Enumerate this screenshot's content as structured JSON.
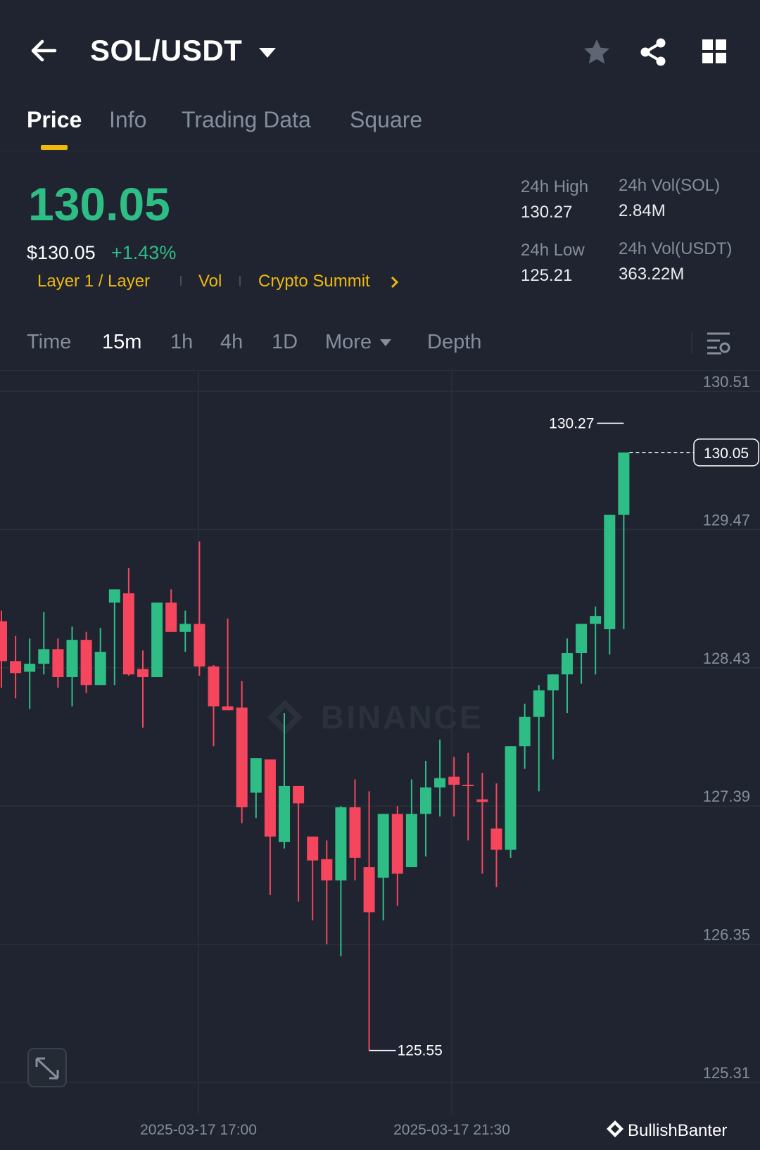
{
  "header": {
    "pair": "SOL/USDT",
    "back_icon": "arrow-left-icon",
    "icons": [
      "star-icon",
      "share-icon",
      "grid-icon"
    ]
  },
  "tabs": [
    {
      "label": "Price",
      "active": true
    },
    {
      "label": "Info",
      "active": false
    },
    {
      "label": "Trading Data",
      "active": false
    },
    {
      "label": "Square",
      "active": false
    }
  ],
  "price": {
    "last": "130.05",
    "usd": "$130.05",
    "change": "+1.43%",
    "color_up": "#2ebd85",
    "color_down": "#f6465d"
  },
  "tags": [
    "Layer 1 / Layer",
    "Vol",
    "Crypto Summit"
  ],
  "stats": {
    "high_label": "24h High",
    "high": "130.27",
    "low_label": "24h Low",
    "low": "125.21",
    "vol_base_label": "24h Vol(SOL)",
    "vol_base": "2.84M",
    "vol_quote_label": "24h Vol(USDT)",
    "vol_quote": "363.22M"
  },
  "timeframes": [
    {
      "label": "Time",
      "active": false
    },
    {
      "label": "15m",
      "active": true
    },
    {
      "label": "1h",
      "active": false
    },
    {
      "label": "4h",
      "active": false
    },
    {
      "label": "1D",
      "active": false
    },
    {
      "label": "More",
      "active": false
    },
    {
      "label": "Depth",
      "active": false
    }
  ],
  "chart_data": {
    "type": "candlestick",
    "y_ticks": [
      "130.51",
      "129.47",
      "128.43",
      "127.39",
      "126.35",
      "125.31"
    ],
    "ylim": [
      125.31,
      130.51
    ],
    "x_ticks": [
      "2025-03-17 17:00",
      "2025-03-17 21:30"
    ],
    "watermark": "BINANCE",
    "high_marker": "130.27",
    "low_marker": "125.55",
    "last_price": "130.05",
    "candles": [
      {
        "o": 128.78,
        "h": 128.86,
        "l": 128.28,
        "c": 128.48
      },
      {
        "o": 128.48,
        "h": 128.67,
        "l": 128.2,
        "c": 128.39
      },
      {
        "o": 128.4,
        "h": 128.65,
        "l": 128.12,
        "c": 128.46
      },
      {
        "o": 128.46,
        "h": 128.85,
        "l": 128.38,
        "c": 128.57
      },
      {
        "o": 128.57,
        "h": 128.65,
        "l": 128.28,
        "c": 128.36
      },
      {
        "o": 128.36,
        "h": 128.74,
        "l": 128.14,
        "c": 128.64
      },
      {
        "o": 128.64,
        "h": 128.7,
        "l": 128.24,
        "c": 128.3
      },
      {
        "o": 128.3,
        "h": 128.73,
        "l": 128.3,
        "c": 128.55
      },
      {
        "o": 128.92,
        "h": 128.98,
        "l": 128.3,
        "c": 129.02
      },
      {
        "o": 128.99,
        "h": 129.18,
        "l": 128.37,
        "c": 128.38
      },
      {
        "o": 128.42,
        "h": 128.56,
        "l": 127.98,
        "c": 128.36
      },
      {
        "o": 128.36,
        "h": 128.92,
        "l": 128.36,
        "c": 128.92
      },
      {
        "o": 128.92,
        "h": 129.02,
        "l": 128.7,
        "c": 128.7
      },
      {
        "o": 128.7,
        "h": 128.86,
        "l": 128.55,
        "c": 128.76
      },
      {
        "o": 128.76,
        "h": 129.38,
        "l": 128.37,
        "c": 128.44
      },
      {
        "o": 128.44,
        "h": 128.45,
        "l": 127.84,
        "c": 128.14
      },
      {
        "o": 128.14,
        "h": 128.8,
        "l": 128.14,
        "c": 128.11
      },
      {
        "o": 128.13,
        "h": 128.33,
        "l": 127.26,
        "c": 127.38
      },
      {
        "o": 127.49,
        "h": 127.49,
        "l": 127.3,
        "c": 127.75
      },
      {
        "o": 127.74,
        "h": 127.36,
        "l": 126.72,
        "c": 127.16
      },
      {
        "o": 127.12,
        "h": 128.09,
        "l": 127.07,
        "c": 127.54
      },
      {
        "o": 127.54,
        "h": 127.54,
        "l": 126.67,
        "c": 127.41
      },
      {
        "o": 127.16,
        "h": 127.1,
        "l": 126.53,
        "c": 126.98
      },
      {
        "o": 126.99,
        "h": 127.13,
        "l": 126.35,
        "c": 126.83
      },
      {
        "o": 126.83,
        "h": 127.39,
        "l": 126.26,
        "c": 127.38
      },
      {
        "o": 127.38,
        "h": 127.59,
        "l": 126.83,
        "c": 127.0
      },
      {
        "o": 126.93,
        "h": 127.5,
        "l": 125.55,
        "c": 126.59
      },
      {
        "o": 126.85,
        "h": 127.19,
        "l": 126.53,
        "c": 127.33
      },
      {
        "o": 127.33,
        "h": 127.39,
        "l": 126.64,
        "c": 126.88
      },
      {
        "o": 126.93,
        "h": 127.59,
        "l": 126.93,
        "c": 127.33
      },
      {
        "o": 127.33,
        "h": 127.73,
        "l": 127.01,
        "c": 127.53
      },
      {
        "o": 127.53,
        "h": 127.89,
        "l": 127.31,
        "c": 127.6
      },
      {
        "o": 127.61,
        "h": 127.76,
        "l": 127.31,
        "c": 127.55
      },
      {
        "o": 127.55,
        "h": 127.79,
        "l": 127.13,
        "c": 127.54
      },
      {
        "o": 127.44,
        "h": 127.64,
        "l": 126.88,
        "c": 127.42
      },
      {
        "o": 127.22,
        "h": 127.56,
        "l": 126.78,
        "c": 127.06
      },
      {
        "o": 127.06,
        "h": 127.84,
        "l": 127.0,
        "c": 127.84
      },
      {
        "o": 127.84,
        "h": 128.16,
        "l": 127.67,
        "c": 128.06
      },
      {
        "o": 128.06,
        "h": 128.3,
        "l": 127.5,
        "c": 128.26
      },
      {
        "o": 128.26,
        "h": 128.3,
        "l": 127.74,
        "c": 128.38
      },
      {
        "o": 128.38,
        "h": 128.65,
        "l": 128.09,
        "c": 128.54
      },
      {
        "o": 128.54,
        "h": 128.65,
        "l": 128.31,
        "c": 128.76
      },
      {
        "o": 128.76,
        "h": 128.89,
        "l": 128.38,
        "c": 128.82
      },
      {
        "o": 128.72,
        "h": 128.89,
        "l": 128.53,
        "c": 129.58
      },
      {
        "o": 129.58,
        "h": 129.76,
        "l": 128.72,
        "c": 130.05
      }
    ]
  },
  "footer": {
    "credit": "BullishBanter",
    "expand_icon": "expand-icon",
    "settings_icon": "chart-settings-icon"
  }
}
